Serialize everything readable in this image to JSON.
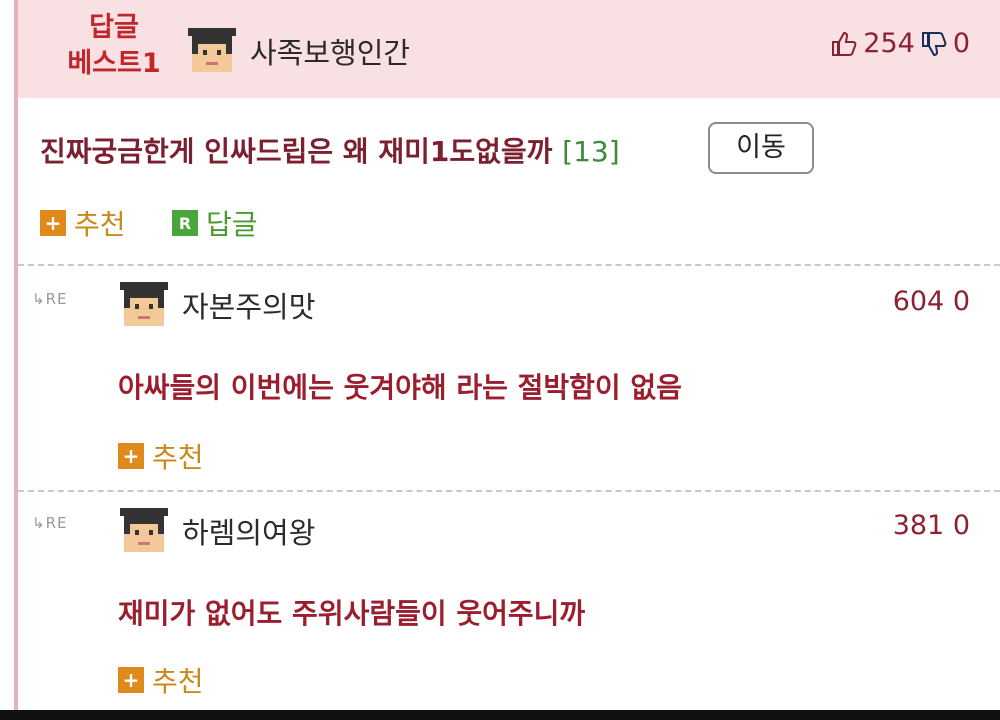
{
  "best": {
    "label_line1": "답글",
    "label_line2": "베스트1",
    "author": "사족보행인간",
    "likes": "254",
    "dislikes": "0"
  },
  "post": {
    "title": "진짜궁금한게 인싸드립은 왜 재미1도없을까",
    "comment_count": "[13]",
    "move_label": "이동",
    "recommend_label": "추천",
    "reply_label": "답글",
    "reply_icon_text": "R",
    "plus_icon_text": "+"
  },
  "replies": [
    {
      "re_mark": "RE",
      "author": "자본주의맛",
      "score": "604 0",
      "text": "아싸들의 이번에는 웃겨야해 라는 절박함이 없음",
      "recommend_label": "추천"
    },
    {
      "re_mark": "RE",
      "author": "하렘의여왕",
      "score": "381 0",
      "text": "재미가 없어도 주위사람들이 웃어주니까",
      "recommend_label": "추천"
    }
  ],
  "colors": {
    "header_bg": "#f8e0e3",
    "accent_red": "#c0272d",
    "reply_text": "#9b1e2e",
    "recommend_orange": "#e08a1c",
    "reply_green": "#4aa63c"
  }
}
